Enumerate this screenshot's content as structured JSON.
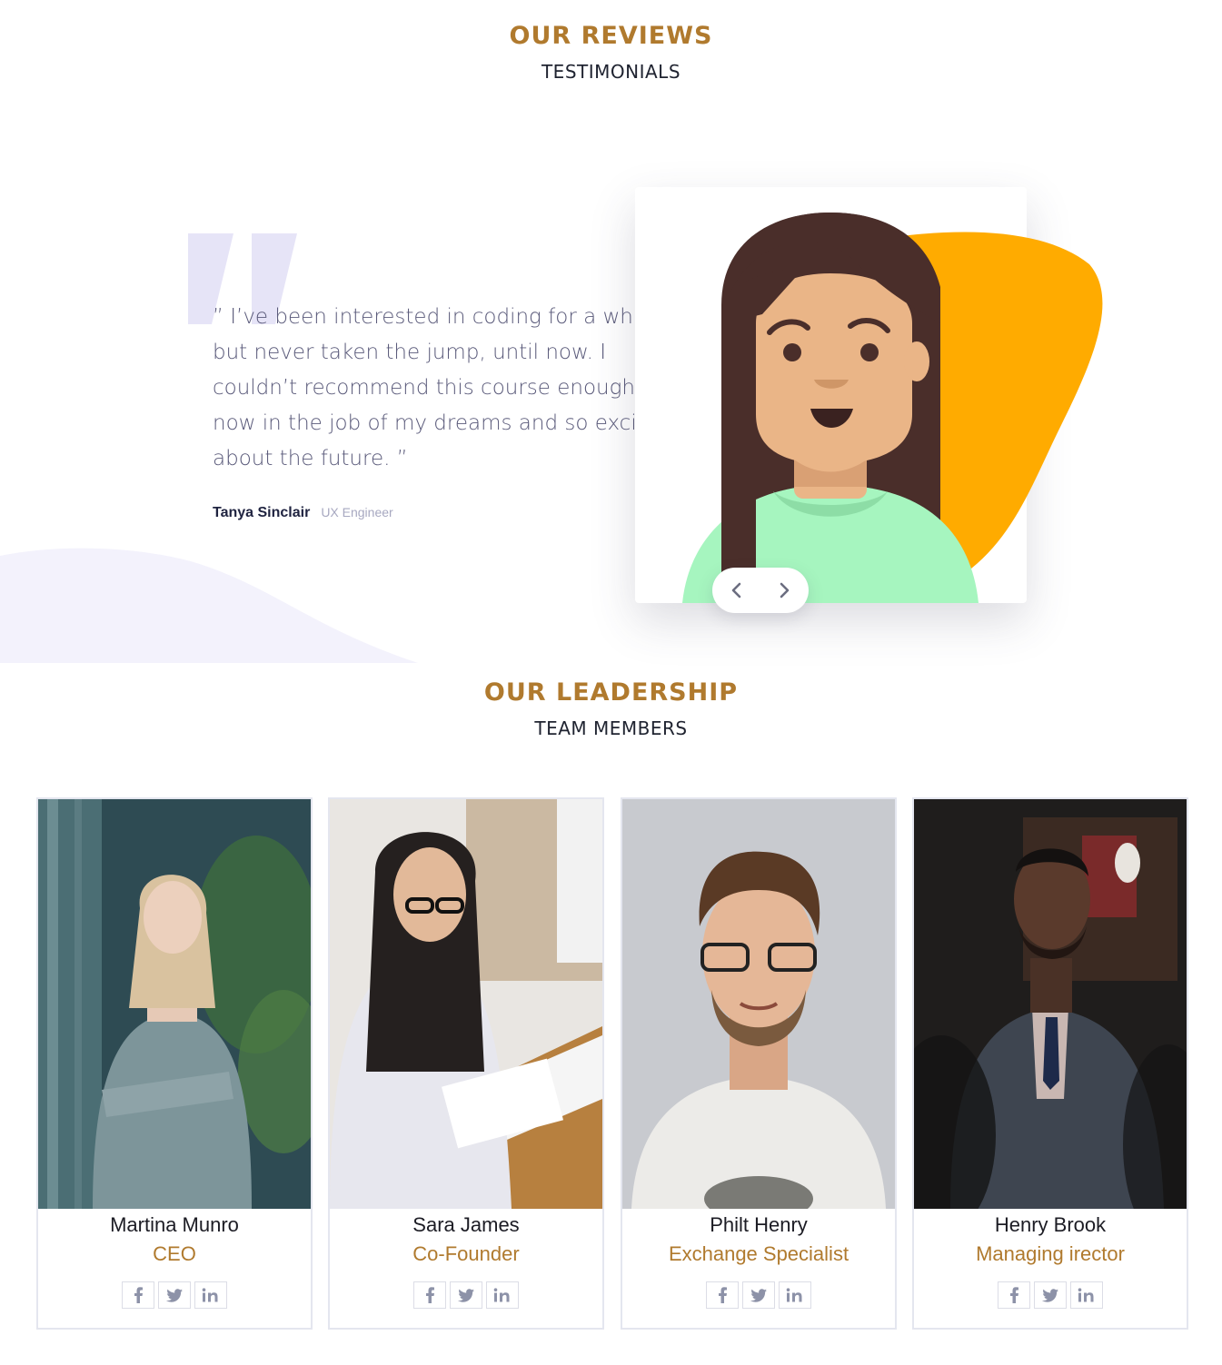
{
  "reviews": {
    "eyebrow": "OUR REVIEWS",
    "subtitle": "TESTIMONIALS",
    "quote": "” I’ve been interested in coding for a while but never taken the jump, until now. I couldn’t recommend this course enough. I’m now in the job of my dreams and so excited about the future. ”",
    "author_name": "Tanya Sinclair",
    "author_role": "UX Engineer",
    "prev_icon": "chevron-left-icon",
    "next_icon": "chevron-right-icon"
  },
  "team": {
    "eyebrow": "OUR LEADERSHIP",
    "subtitle": "TEAM MEMBERS",
    "members": [
      {
        "name": "Martina Munro",
        "role": "CEO"
      },
      {
        "name": "Sara James",
        "role": "Co-Founder"
      },
      {
        "name": "Philt Henry",
        "role": "Exchange Specialist"
      },
      {
        "name": "Henry Brook",
        "role": "Managing irector"
      }
    ],
    "social_icons": [
      "facebook-icon",
      "twitter-icon",
      "linkedin-icon"
    ]
  },
  "colors": {
    "accent": "#b07a2e",
    "heading": "#1f2330",
    "quote_text": "#5a5a7a",
    "blob": "#ffab00",
    "shirt": "#a6f5bf",
    "hair": "#4a2e2a",
    "skin": "#eab587"
  }
}
